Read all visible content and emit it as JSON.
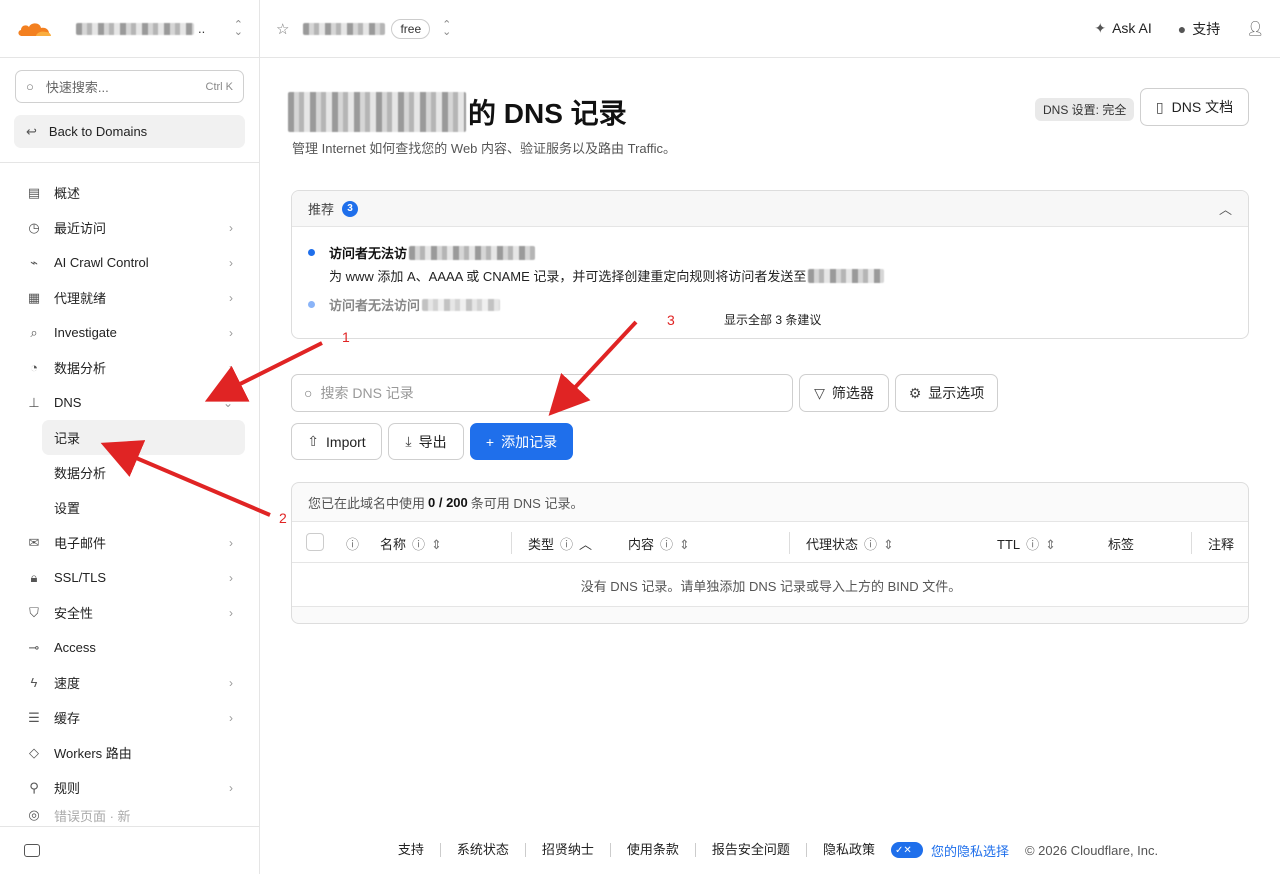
{
  "sidebar": {
    "account_dots": "..",
    "search_placeholder": "快速搜索...",
    "search_shortcut": "Ctrl K",
    "back_label": "Back to Domains",
    "items": [
      {
        "label": "概述",
        "icon": "document-icon",
        "chevron": false
      },
      {
        "label": "最近访问",
        "icon": "clock-icon",
        "chevron": true
      },
      {
        "label": "AI Crawl Control",
        "icon": "ai-crawl-icon",
        "chevron": true
      },
      {
        "label": "代理就绪",
        "icon": "proxy-icon",
        "chevron": true
      },
      {
        "label": "Investigate",
        "icon": "search-investigate-icon",
        "chevron": true
      },
      {
        "label": "数据分析",
        "icon": "pie-chart-icon",
        "chevron": true
      },
      {
        "label": "DNS",
        "icon": "network-icon",
        "chevron": true
      }
    ],
    "dns_sub": [
      "记录",
      "数据分析",
      "设置"
    ],
    "items_after": [
      {
        "label": "电子邮件",
        "icon": "mail-icon",
        "chevron": true
      },
      {
        "label": "SSL/TLS",
        "icon": "lock-icon",
        "chevron": true
      },
      {
        "label": "安全性",
        "icon": "shield-icon",
        "chevron": true
      },
      {
        "label": "Access",
        "icon": "access-icon",
        "chevron": false
      },
      {
        "label": "速度",
        "icon": "bolt-icon",
        "chevron": true
      },
      {
        "label": "缓存",
        "icon": "database-icon",
        "chevron": true
      },
      {
        "label": "Workers 路由",
        "icon": "workers-icon",
        "chevron": false
      },
      {
        "label": "规则",
        "icon": "rules-icon",
        "chevron": true
      },
      {
        "label": "错误页面 · 新",
        "icon": "error-page-icon",
        "chevron": false
      }
    ]
  },
  "topbar": {
    "plan": "free",
    "ask_ai": "Ask AI",
    "support": "支持"
  },
  "header": {
    "title": "的 DNS 记录",
    "subtitle": "管理 Internet 如何查找您的 Web 内容、验证服务以及路由 Traffic。",
    "dns_setting_badge": "DNS 设置: 完全",
    "docs_button": "DNS 文档"
  },
  "recommendations": {
    "label": "推荐",
    "count": "3",
    "item1_title": "访问者无法访",
    "item1_desc": "为 www 添加 A、AAAA 或 CNAME 记录，并可选择创建重定向规则将访问者发送至",
    "item2_title": "访问者无法访问",
    "show_all": "显示全部 3 条建议"
  },
  "toolbar": {
    "search_placeholder": "搜索 DNS 记录",
    "filter": "筛选器",
    "display_options": "显示选项",
    "import": "Import",
    "export": "导出",
    "add_record": "添加记录"
  },
  "table": {
    "usage_prefix": "您已在此域名中使用",
    "usage_count": "0 / 200",
    "usage_suffix": "条可用 DNS 记录。",
    "columns": [
      "名称",
      "类型",
      "内容",
      "代理状态",
      "TTL",
      "标签",
      "注释"
    ],
    "empty": "没有 DNS 记录。请单独添加 DNS 记录或导入上方的 BIND 文件。"
  },
  "footer": {
    "links": [
      "支持",
      "系统状态",
      "招贤纳士",
      "使用条款",
      "报告安全问题",
      "隐私政策"
    ],
    "privacy_choice": "您的隐私选择",
    "copyright": "© 2026 Cloudflare, Inc."
  },
  "annotations": [
    "1",
    "2",
    "3"
  ],
  "colors": {
    "accent": "#1f6feb",
    "cloudflare_orange": "#f38020",
    "annotation_red": "#e02424"
  }
}
